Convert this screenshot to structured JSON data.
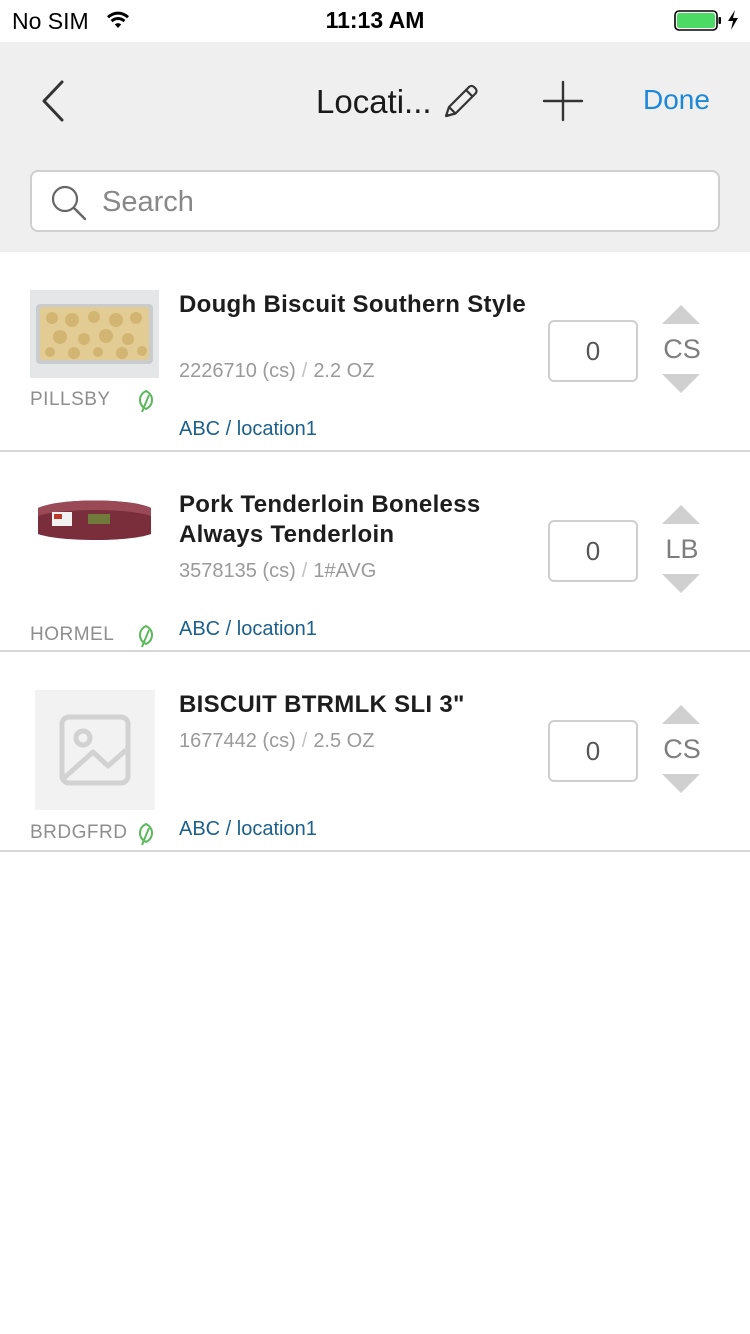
{
  "status_bar": {
    "carrier": "No SIM",
    "time": "11:13 AM",
    "battery_color": "#4cd964"
  },
  "nav": {
    "back_icon": "chevron-left-icon",
    "title": "Locati...",
    "edit_icon": "pencil-icon",
    "add_icon": "plus-icon",
    "done_label": "Done",
    "accent_color": "#1e88d8"
  },
  "search": {
    "placeholder": "Search",
    "value": ""
  },
  "items": [
    {
      "name": "Dough Biscuit Southern Style",
      "code": "2226710 (cs)",
      "pack": "2.2 OZ",
      "brand": "PILLSBY",
      "location": "ABC / location1",
      "quantity": "0",
      "unit": "CS",
      "image": "biscuit-tray-photo"
    },
    {
      "name": "Pork Tenderloin Boneless Always Tenderloin",
      "code": "3578135 (cs)",
      "pack": "1#AVG",
      "brand": "HORMEL",
      "location": "ABC / location1",
      "quantity": "0",
      "unit": "LB",
      "image": "pork-tenderloin-photo"
    },
    {
      "name": "BISCUIT BTRMLK SLI 3\"",
      "code": "1677442 (cs)",
      "pack": "2.5 OZ",
      "brand": "BRDGFRD",
      "location": "ABC / location1",
      "quantity": "0",
      "unit": "CS",
      "image": "image-placeholder-icon"
    }
  ],
  "colors": {
    "leaf": "#5cb85c",
    "location_text": "#1b5f8c"
  }
}
